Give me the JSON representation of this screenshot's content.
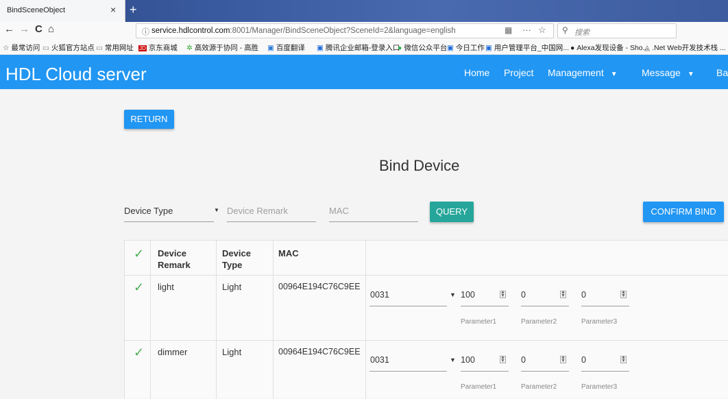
{
  "browser": {
    "tab_title": "BindSceneObject",
    "tab_close": "×",
    "new_tab": "+",
    "back": "←",
    "forward": "→",
    "reload": "C",
    "home": "⌂",
    "url_host": "service.hdlcontrol.com",
    "url_prefix": "",
    "url_suffix": ":8001/Manager/BindSceneObject?SceneId=2&language=english",
    "url_more": "···",
    "url_star": "☆",
    "search_placeholder": "搜索",
    "bookmarks": [
      {
        "icon": "☆",
        "label": "最常访问"
      },
      {
        "icon": "▭",
        "label": "火狐官方站点"
      },
      {
        "icon": "▭",
        "label": "常用网址"
      },
      {
        "icon": "JD",
        "label": "京东商城"
      },
      {
        "icon": "✲",
        "label": "高效源于协同 - 高胜"
      },
      {
        "icon": "▣",
        "label": "百度翻译"
      },
      {
        "icon": "▣",
        "label": "腾讯企业邮箱-登录入口"
      },
      {
        "icon": "●",
        "label": "微信公众平台"
      },
      {
        "icon": "▣",
        "label": "今日工作"
      },
      {
        "icon": "▣",
        "label": "用户管理平台_中国网..."
      },
      {
        "icon": "●",
        "label": "Alexa发现设备 - Sho..."
      },
      {
        "icon": "◬",
        "label": ".Net Web开发技术栈 ..."
      }
    ]
  },
  "app": {
    "brand": "HDL Cloud server",
    "menu": {
      "home": "Home",
      "project": "Project",
      "management": "Management",
      "message": "Message",
      "more": "Ba"
    },
    "caret": "▼"
  },
  "page": {
    "return_label": "RETURN",
    "title": "Bind Device",
    "filters": {
      "device_type": "Device Type",
      "device_remark": "Device Remark",
      "mac": "MAC",
      "caret": "▼"
    },
    "query_label": "QUERY",
    "confirm_label": "CONFIRM BIND",
    "table": {
      "check": "✓",
      "headers": {
        "remark_1": "Device",
        "remark_2": "Remark",
        "type_1": "Device",
        "type_2": "Type",
        "mac": "MAC"
      },
      "rows": [
        {
          "remark": "light",
          "type": "Light",
          "mac": "00964E194C76C9EE",
          "channel": "0031",
          "p1": "100",
          "p2": "0",
          "p3": "0"
        },
        {
          "remark": "dimmer",
          "type": "Light",
          "mac": "00964E194C76C9EE",
          "channel": "0031",
          "p1": "100",
          "p2": "0",
          "p3": "0"
        }
      ],
      "param_labels": [
        "Parameter1",
        "Parameter2",
        "Parameter3"
      ],
      "sel_caret": "▼",
      "spin_up": "▲",
      "spin_down": "▼"
    },
    "colors": {
      "primary": "#2196f3",
      "query": "#26a69a",
      "check": "#4caf50"
    }
  }
}
